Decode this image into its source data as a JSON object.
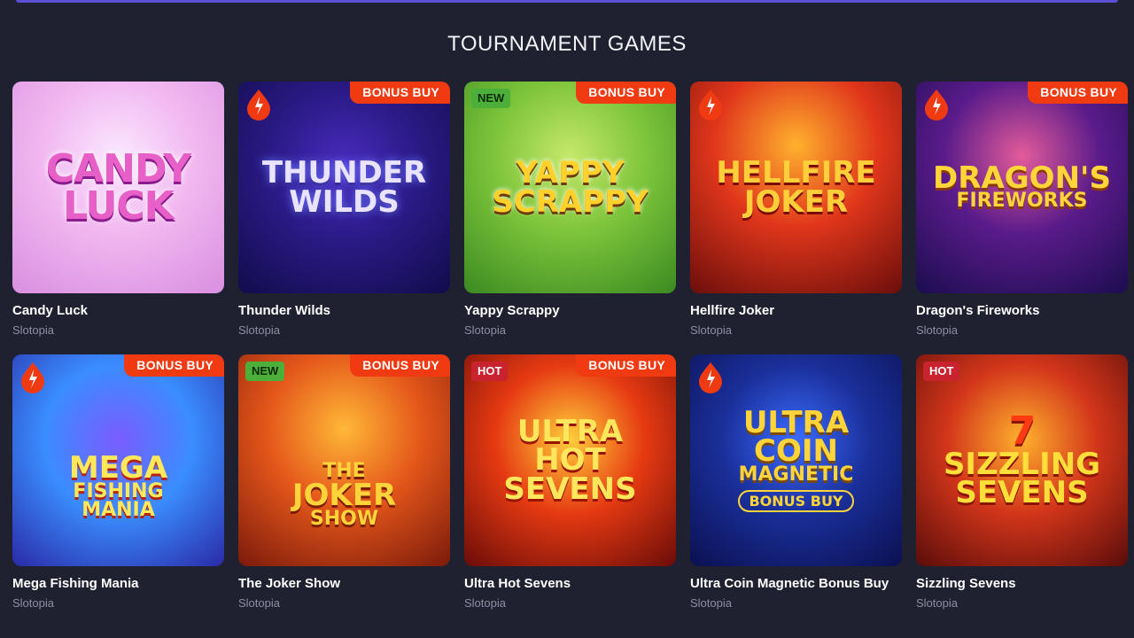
{
  "section": {
    "title": "TOURNAMENT GAMES"
  },
  "colors": {
    "background": "#1f2130",
    "bonus_badge": "#ef3a12",
    "new_badge": "#4caf3a",
    "hot_badge": "#c8232f",
    "accent_bar": "#5b4fd6"
  },
  "games": [
    {
      "name": "Candy Luck",
      "provider": "Slotopia",
      "badges": [],
      "art": [
        "CANDY",
        "LUCK"
      ]
    },
    {
      "name": "Thunder Wilds",
      "provider": "Slotopia",
      "badges": [
        "BONUS BUY"
      ],
      "icon": "flame-drop-icon",
      "art": [
        "THUNDER",
        "WILDS"
      ]
    },
    {
      "name": "Yappy Scrappy",
      "provider": "Slotopia",
      "badges": [
        "NEW",
        "BONUS BUY"
      ],
      "art": [
        "YAPPY",
        "SCRAPPY"
      ]
    },
    {
      "name": "Hellfire Joker",
      "provider": "Slotopia",
      "badges": [],
      "icon": "flame-drop-icon",
      "art": [
        "HELLFIRE",
        "JOKER"
      ]
    },
    {
      "name": "Dragon's Fireworks",
      "provider": "Slotopia",
      "badges": [
        "BONUS BUY"
      ],
      "icon": "flame-drop-icon",
      "art": [
        "DRAGON'S",
        "FIREWORKS"
      ]
    },
    {
      "name": "Mega Fishing Mania",
      "provider": "Slotopia",
      "badges": [
        "BONUS BUY"
      ],
      "icon": "flame-drop-icon",
      "art": [
        "MEGA",
        "FISHING",
        "MANIA"
      ]
    },
    {
      "name": "The Joker Show",
      "provider": "Slotopia",
      "badges": [
        "NEW",
        "BONUS BUY"
      ],
      "art": [
        "THE",
        "JOKER",
        "SHOW"
      ]
    },
    {
      "name": "Ultra Hot Sevens",
      "provider": "Slotopia",
      "badges": [
        "HOT",
        "BONUS BUY"
      ],
      "art": [
        "ULTRA",
        "HOT",
        "SEVENS"
      ]
    },
    {
      "name": "Ultra Coin Magnetic Bonus Buy",
      "provider": "Slotopia",
      "badges": [],
      "icon": "flame-drop-icon",
      "art": [
        "ULTRA",
        "COIN",
        "MAGNETIC"
      ],
      "art_pill": "BONUS BUY"
    },
    {
      "name": "Sizzling Sevens",
      "provider": "Slotopia",
      "badges": [
        "HOT"
      ],
      "art": [
        "7",
        "SIZZLING",
        "SEVENS"
      ]
    }
  ]
}
